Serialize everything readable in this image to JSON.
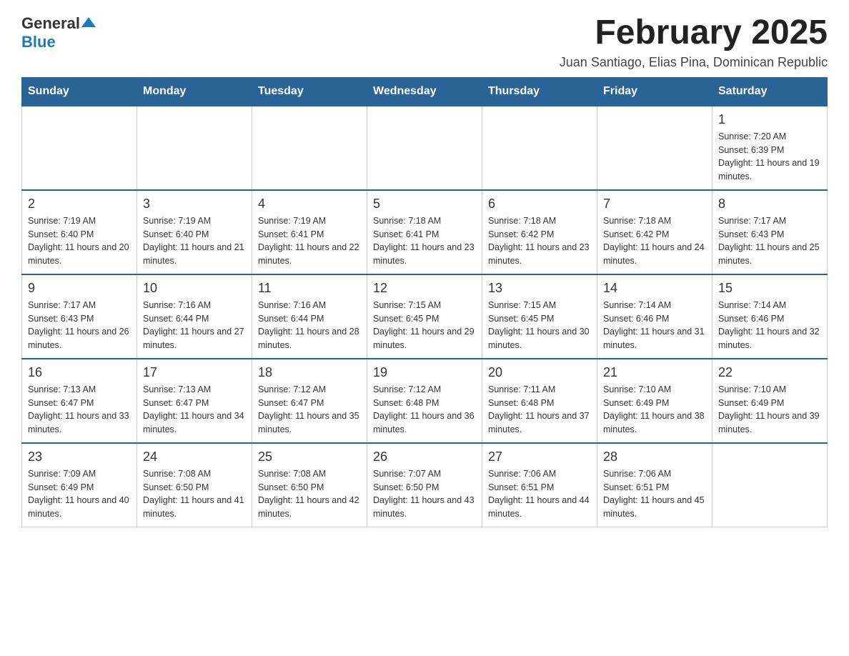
{
  "header": {
    "logo": {
      "general": "General",
      "blue": "Blue"
    },
    "title": "February 2025",
    "location": "Juan Santiago, Elias Pina, Dominican Republic"
  },
  "calendar": {
    "weekdays": [
      "Sunday",
      "Monday",
      "Tuesday",
      "Wednesday",
      "Thursday",
      "Friday",
      "Saturday"
    ],
    "weeks": [
      [
        {
          "day": "",
          "info": ""
        },
        {
          "day": "",
          "info": ""
        },
        {
          "day": "",
          "info": ""
        },
        {
          "day": "",
          "info": ""
        },
        {
          "day": "",
          "info": ""
        },
        {
          "day": "",
          "info": ""
        },
        {
          "day": "1",
          "info": "Sunrise: 7:20 AM\nSunset: 6:39 PM\nDaylight: 11 hours and 19 minutes."
        }
      ],
      [
        {
          "day": "2",
          "info": "Sunrise: 7:19 AM\nSunset: 6:40 PM\nDaylight: 11 hours and 20 minutes."
        },
        {
          "day": "3",
          "info": "Sunrise: 7:19 AM\nSunset: 6:40 PM\nDaylight: 11 hours and 21 minutes."
        },
        {
          "day": "4",
          "info": "Sunrise: 7:19 AM\nSunset: 6:41 PM\nDaylight: 11 hours and 22 minutes."
        },
        {
          "day": "5",
          "info": "Sunrise: 7:18 AM\nSunset: 6:41 PM\nDaylight: 11 hours and 23 minutes."
        },
        {
          "day": "6",
          "info": "Sunrise: 7:18 AM\nSunset: 6:42 PM\nDaylight: 11 hours and 23 minutes."
        },
        {
          "day": "7",
          "info": "Sunrise: 7:18 AM\nSunset: 6:42 PM\nDaylight: 11 hours and 24 minutes."
        },
        {
          "day": "8",
          "info": "Sunrise: 7:17 AM\nSunset: 6:43 PM\nDaylight: 11 hours and 25 minutes."
        }
      ],
      [
        {
          "day": "9",
          "info": "Sunrise: 7:17 AM\nSunset: 6:43 PM\nDaylight: 11 hours and 26 minutes."
        },
        {
          "day": "10",
          "info": "Sunrise: 7:16 AM\nSunset: 6:44 PM\nDaylight: 11 hours and 27 minutes."
        },
        {
          "day": "11",
          "info": "Sunrise: 7:16 AM\nSunset: 6:44 PM\nDaylight: 11 hours and 28 minutes."
        },
        {
          "day": "12",
          "info": "Sunrise: 7:15 AM\nSunset: 6:45 PM\nDaylight: 11 hours and 29 minutes."
        },
        {
          "day": "13",
          "info": "Sunrise: 7:15 AM\nSunset: 6:45 PM\nDaylight: 11 hours and 30 minutes."
        },
        {
          "day": "14",
          "info": "Sunrise: 7:14 AM\nSunset: 6:46 PM\nDaylight: 11 hours and 31 minutes."
        },
        {
          "day": "15",
          "info": "Sunrise: 7:14 AM\nSunset: 6:46 PM\nDaylight: 11 hours and 32 minutes."
        }
      ],
      [
        {
          "day": "16",
          "info": "Sunrise: 7:13 AM\nSunset: 6:47 PM\nDaylight: 11 hours and 33 minutes."
        },
        {
          "day": "17",
          "info": "Sunrise: 7:13 AM\nSunset: 6:47 PM\nDaylight: 11 hours and 34 minutes."
        },
        {
          "day": "18",
          "info": "Sunrise: 7:12 AM\nSunset: 6:47 PM\nDaylight: 11 hours and 35 minutes."
        },
        {
          "day": "19",
          "info": "Sunrise: 7:12 AM\nSunset: 6:48 PM\nDaylight: 11 hours and 36 minutes."
        },
        {
          "day": "20",
          "info": "Sunrise: 7:11 AM\nSunset: 6:48 PM\nDaylight: 11 hours and 37 minutes."
        },
        {
          "day": "21",
          "info": "Sunrise: 7:10 AM\nSunset: 6:49 PM\nDaylight: 11 hours and 38 minutes."
        },
        {
          "day": "22",
          "info": "Sunrise: 7:10 AM\nSunset: 6:49 PM\nDaylight: 11 hours and 39 minutes."
        }
      ],
      [
        {
          "day": "23",
          "info": "Sunrise: 7:09 AM\nSunset: 6:49 PM\nDaylight: 11 hours and 40 minutes."
        },
        {
          "day": "24",
          "info": "Sunrise: 7:08 AM\nSunset: 6:50 PM\nDaylight: 11 hours and 41 minutes."
        },
        {
          "day": "25",
          "info": "Sunrise: 7:08 AM\nSunset: 6:50 PM\nDaylight: 11 hours and 42 minutes."
        },
        {
          "day": "26",
          "info": "Sunrise: 7:07 AM\nSunset: 6:50 PM\nDaylight: 11 hours and 43 minutes."
        },
        {
          "day": "27",
          "info": "Sunrise: 7:06 AM\nSunset: 6:51 PM\nDaylight: 11 hours and 44 minutes."
        },
        {
          "day": "28",
          "info": "Sunrise: 7:06 AM\nSunset: 6:51 PM\nDaylight: 11 hours and 45 minutes."
        },
        {
          "day": "",
          "info": ""
        }
      ]
    ]
  }
}
